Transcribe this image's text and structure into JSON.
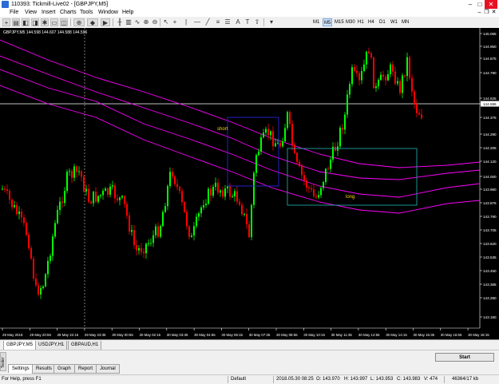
{
  "window": {
    "title": "110393: Tickmill-Live02 - [GBPJPY,M5]",
    "controls": [
      "–",
      "□",
      "✕"
    ]
  },
  "menu": [
    "File",
    "View",
    "Insert",
    "Charts",
    "Tools",
    "Window",
    "Help"
  ],
  "mdi_controls": [
    "–",
    "❐",
    "✕"
  ],
  "toolbar": {
    "timeframes": [
      "M1",
      "M5",
      "M15",
      "M30",
      "H1",
      "H4",
      "D1",
      "W1",
      "MN"
    ],
    "selected": "M5"
  },
  "chart": {
    "symbol_line": "GBPJPY,M5  144.598 144.607 144.588 144.596",
    "price_labels": [
      "145.065",
      "144.950",
      "144.875",
      "144.790",
      "144.625",
      "144.596",
      "144.375",
      "144.290",
      "144.205",
      "144.120",
      "144.000",
      "143.960",
      "143.875",
      "143.790",
      "143.705",
      "143.620",
      "143.535",
      "143.450",
      "143.365",
      "143.280",
      "143.160"
    ],
    "current_price": "144.596",
    "time_labels": [
      "29 May 2018",
      "29 May 20:55",
      "29 May 22:15",
      "29 May 23:35",
      "30 May 00:55",
      "30 May 02:15",
      "30 May 03:35",
      "30 May 04:55",
      "30 May 06:15",
      "30 May 07:35",
      "30 May 08:55",
      "30 May 10:15",
      "30 May 11:35",
      "30 May 12:55",
      "30 May 14:15",
      "30 May 15:35",
      "30 May 16:55",
      "30 May 18:15"
    ],
    "annotations": {
      "short": "short",
      "long": "long"
    },
    "colors": {
      "bull": "#00ff00",
      "bear": "#ff0000",
      "envelope": "#ff00ff",
      "short_box": "#2626d9",
      "long_box": "#1fa3a3",
      "text": "#ffd700"
    }
  },
  "chart_tabs": [
    "GBPJPY,M5",
    "USDJPY,H1",
    "GBPAUD,H1"
  ],
  "tester": {
    "side_label": "Tester",
    "start_label": "Start",
    "tabs": [
      "Settings",
      "Results",
      "Graph",
      "Report",
      "Journal"
    ]
  },
  "status": {
    "help": "For Help, press F1",
    "profile": "Default",
    "datetime": "2018.05.30 08:25",
    "open": "O: 143.970",
    "high": "H: 143.997",
    "low": "L: 143.953",
    "close": "C: 143.983",
    "volume": "V: 474",
    "traffic": "46364/17 kb"
  }
}
